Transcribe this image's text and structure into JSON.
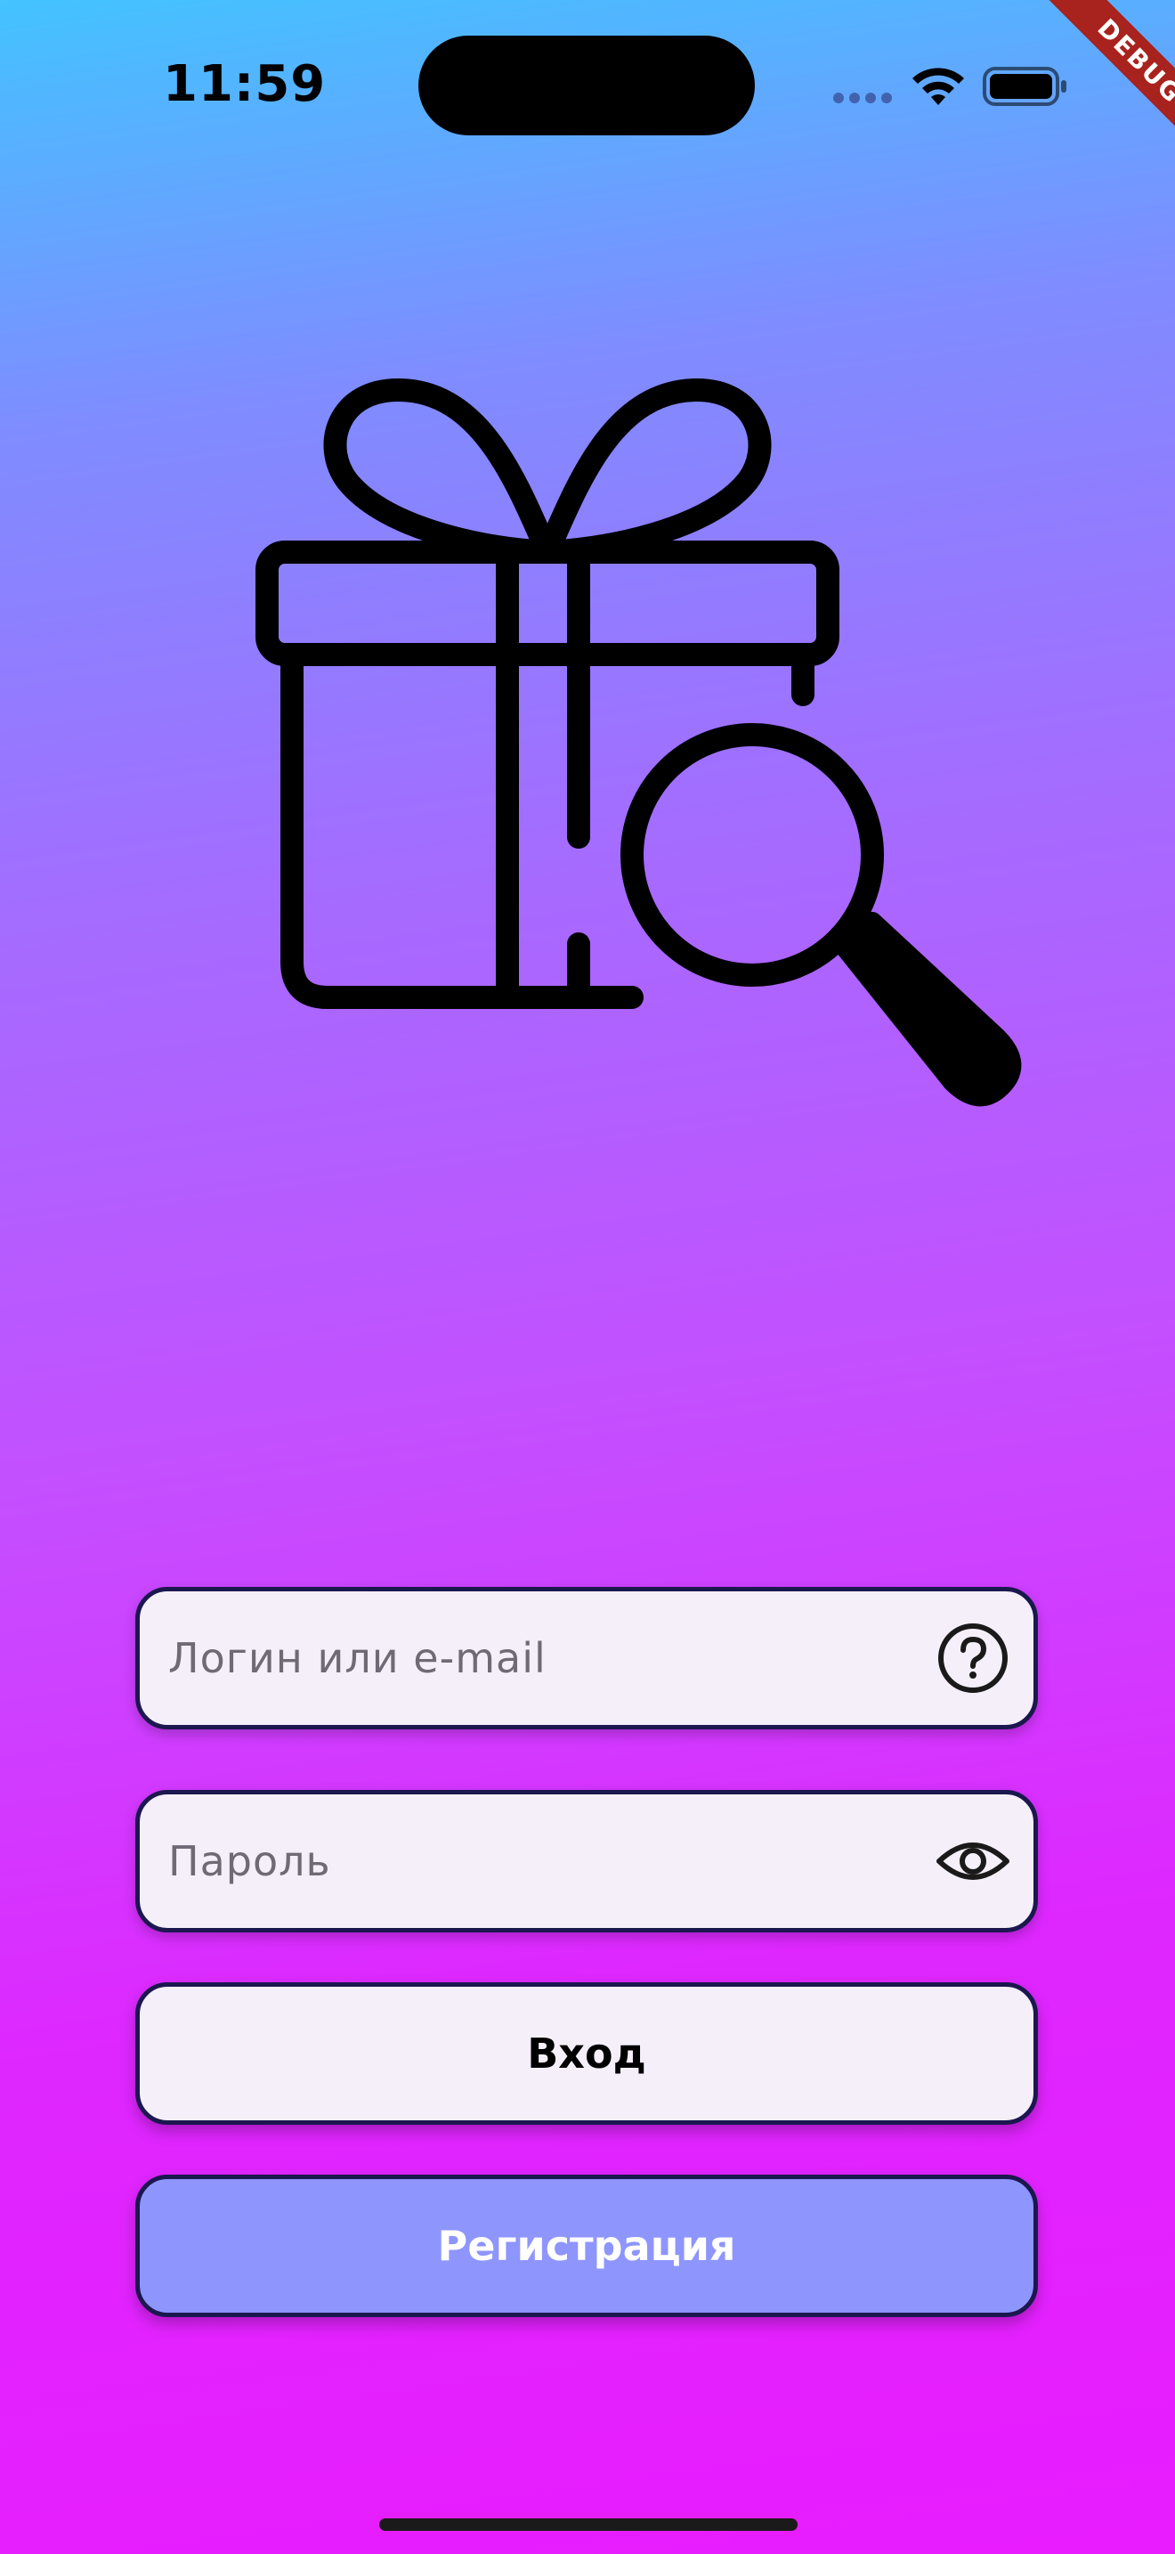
{
  "status_bar": {
    "time": "11:59"
  },
  "debug_banner": {
    "label": "DEBUG"
  },
  "logo": {
    "icon": "gift-search-icon"
  },
  "form": {
    "login_placeholder": "Логин или e-mail",
    "login_help_icon": "question-circle-icon",
    "password_placeholder": "Пароль",
    "password_visibility_icon": "eye-icon",
    "login_button_label": "Вход",
    "register_button_label": "Регистрация"
  },
  "colors": {
    "gradient_top": "#43c3ff",
    "gradient_bottom": "#e81cff",
    "field_background": "#f5effa",
    "border": "#1b174f",
    "register_button": "#8e95fd",
    "debug_banner": "#a8221e"
  }
}
